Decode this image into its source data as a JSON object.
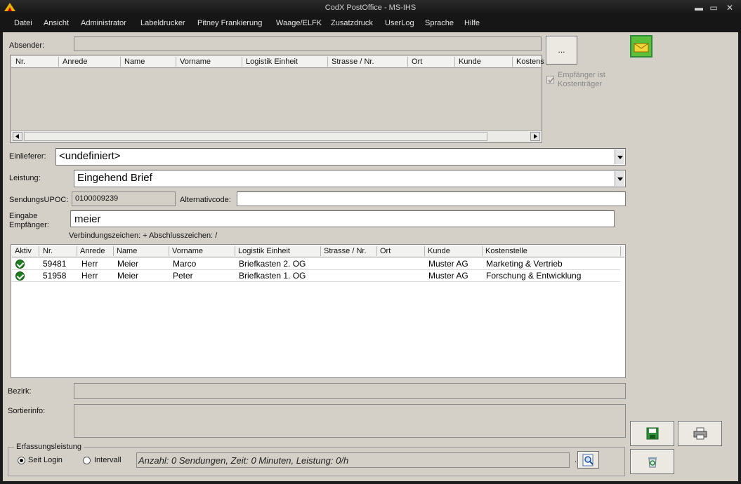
{
  "window": {
    "title": "CodX PostOffice - MS-IHS",
    "minimize": "▬",
    "maximize": "▭",
    "close": "✕"
  },
  "menu": [
    "Datei",
    "Ansicht",
    "Administrator",
    "Labeldrucker",
    "Pitney Frankierung",
    "Waage/ELFK",
    "Zusatzdruck",
    "UserLog",
    "Sprache",
    "Hilfe"
  ],
  "sender": {
    "label": "Absender:",
    "value": "",
    "browse_button": "...",
    "columns": [
      "Nr.",
      "Anrede",
      "Name",
      "Vorname",
      "Logistik Einheit",
      "Strasse / Nr.",
      "Ort",
      "Kunde",
      "Kostens"
    ],
    "cost_bearer_line1": "Empfänger ist",
    "cost_bearer_line2": "Kostenträger"
  },
  "form": {
    "einlieferer_label": "Einlieferer:",
    "einlieferer_value": "<undefiniert>",
    "leistung_label": "Leistung:",
    "leistung_value": "Eingehend  Brief",
    "upoc_label": "SendungsUPOC:",
    "upoc_value": "0100009239",
    "alt_label": "Alternativcode:",
    "alt_value": "",
    "recipient_label_1": "Eingabe",
    "recipient_label_2": "Empfänger:",
    "recipient_value": "meier",
    "hint": "Verbindungszeichen: +   Abschlusszeichen: /"
  },
  "recipients": {
    "columns": [
      "Aktiv",
      "Nr.",
      "Anrede",
      "Name",
      "Vorname",
      "Logistik Einheit",
      "Strasse / Nr.",
      "Ort",
      "Kunde",
      "Kostenstelle"
    ],
    "rows": [
      {
        "nr": "59481",
        "anrede": "Herr",
        "name": "Meier",
        "vorname": "Marco",
        "logistik": "Briefkasten 2. OG",
        "strasse": "",
        "ort": "",
        "kunde": "Muster AG",
        "kostenstelle": "Marketing & Vertrieb"
      },
      {
        "nr": "51958",
        "anrede": "Herr",
        "name": "Meier",
        "vorname": "Peter",
        "logistik": "Briefkasten 1. OG",
        "strasse": "",
        "ort": "",
        "kunde": "Muster AG",
        "kostenstelle": "Forschung & Entwicklung"
      }
    ]
  },
  "bezirk": {
    "label": "Bezirk:",
    "value": ""
  },
  "sortierinfo": {
    "label": "Sortierinfo:",
    "value": ""
  },
  "erfassung": {
    "legend": "Erfassungsleistung",
    "option_login": "Seit Login",
    "option_interval": "Intervall",
    "stats": "Anzahl: 0 Sendungen, Zeit: 0 Minuten, Leistung: 0/h",
    "detail_prefix": "."
  },
  "colors": {
    "chrome": "#161616",
    "panel": "#d4d0c8",
    "accent_green": "#1f7f1f"
  }
}
